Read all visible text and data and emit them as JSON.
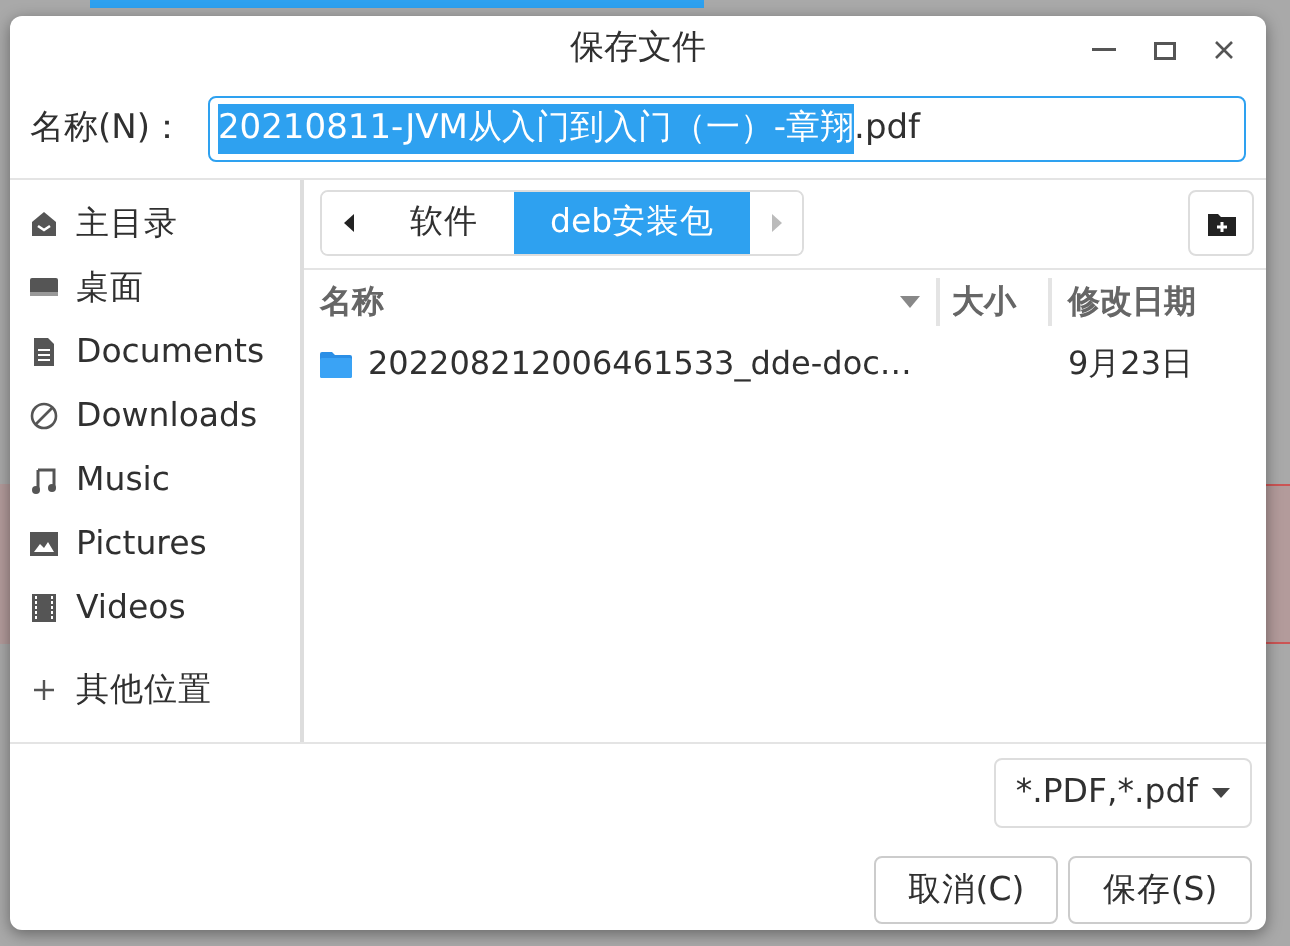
{
  "window": {
    "title": "保存文件"
  },
  "name_field": {
    "label": "名称(N)：",
    "selected_text": "20210811-JVM从入门到入门（一）-章翔",
    "rest_text": ".pdf"
  },
  "sidebar": {
    "items": [
      {
        "label": "主目录",
        "selected": false
      },
      {
        "label": "桌面",
        "selected": false
      },
      {
        "label": "Documents",
        "selected": false
      },
      {
        "label": "Downloads",
        "selected": false
      },
      {
        "label": "Music",
        "selected": false
      },
      {
        "label": "Pictures",
        "selected": false
      },
      {
        "label": "Videos",
        "selected": false
      },
      {
        "label": "其他位置",
        "selected": false
      }
    ]
  },
  "path_bar": {
    "segments": [
      {
        "label": "软件",
        "selected": false
      },
      {
        "label": "deb安装包",
        "selected": true
      }
    ]
  },
  "table": {
    "columns": [
      {
        "label": "名称",
        "sorted": true
      },
      {
        "label": "大小",
        "sorted": false
      },
      {
        "label": "修改日期",
        "sorted": false
      }
    ],
    "rows": [
      {
        "name": "202208212006461533_dde-doc…",
        "modified": "9月23日",
        "kind": "folder"
      }
    ]
  },
  "filter": {
    "value": "*.PDF,*.pdf"
  },
  "buttons": [
    {
      "label": "取消(C)"
    },
    {
      "label": "保存(S)"
    }
  ]
}
